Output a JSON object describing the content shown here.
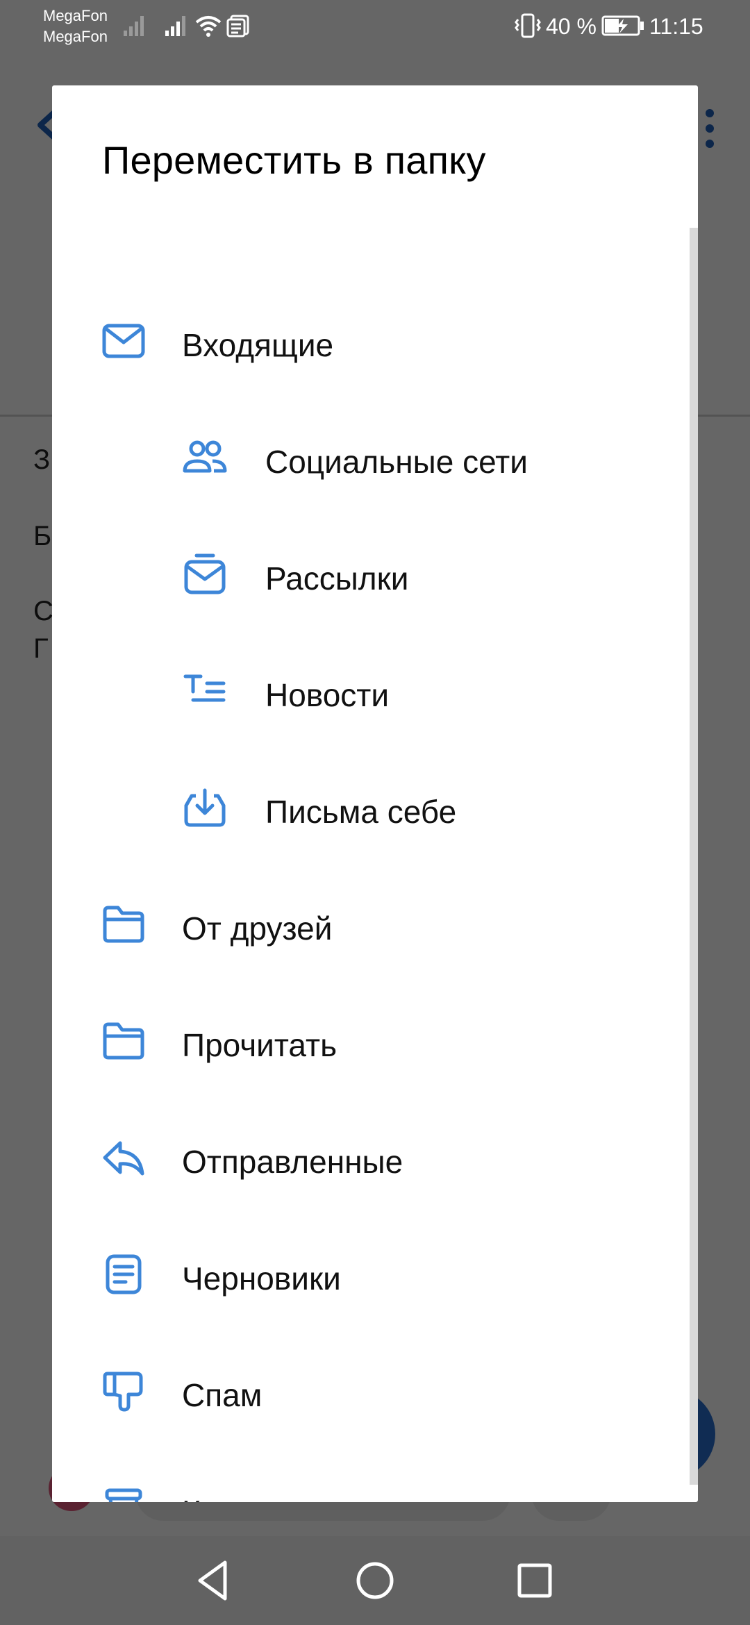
{
  "status_bar": {
    "carrier_1": "MegaFon",
    "carrier_2": "MegaFon",
    "battery_percent": "40 %",
    "time": "11:15",
    "icons": [
      "signal-icon",
      "signal-icon",
      "wifi-icon",
      "notification-icon",
      "vibrate-icon",
      "battery-charging-icon"
    ]
  },
  "dialog": {
    "title": "Переместить в папку",
    "folders": [
      {
        "label": "Входящие",
        "icon": "inbox-icon",
        "level": 0
      },
      {
        "label": "Социальные сети",
        "icon": "people-icon",
        "level": 1
      },
      {
        "label": "Рассылки",
        "icon": "newsletter-icon",
        "level": 1
      },
      {
        "label": "Новости",
        "icon": "news-icon",
        "level": 1
      },
      {
        "label": "Письма себе",
        "icon": "download-box-icon",
        "level": 1
      },
      {
        "label": "От друзей",
        "icon": "folder-icon",
        "level": 0
      },
      {
        "label": "Прочитать",
        "icon": "folder-icon",
        "level": 0
      },
      {
        "label": "Отправленные",
        "icon": "reply-icon",
        "level": 0
      },
      {
        "label": "Черновики",
        "icon": "draft-icon",
        "level": 0
      },
      {
        "label": "Спам",
        "icon": "thumbs-down-icon",
        "level": 0
      },
      {
        "label": "Корзина",
        "icon": "trash-icon",
        "level": 0
      }
    ]
  },
  "background_letters": {
    "l1": "З",
    "l2": "Б",
    "l3": "С",
    "l4": "Г"
  },
  "colors": {
    "accent": "#3d86d8",
    "overlay": "#000000",
    "nav_bar": "#626262"
  }
}
